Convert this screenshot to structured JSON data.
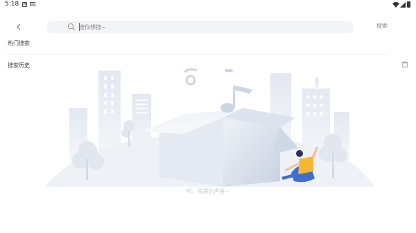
{
  "status_bar": {
    "time": "5:18",
    "notification_icon": "a-badge-icon"
  },
  "header": {
    "back_icon": "chevron-left-icon",
    "search": {
      "placeholder": "搜你想搜~",
      "value": ""
    },
    "search_button_label": "搜索"
  },
  "sections": {
    "hot_search_title": "热门搜索",
    "history_title": "搜索历史",
    "clear_history_icon": "trash-icon"
  },
  "empty_state": {
    "illustration": "music-box-city-illustration",
    "message": "听。海哭的声音~"
  },
  "colors": {
    "accent": "#1f8f5a",
    "search_bg": "#f3f4f6",
    "muted_text": "#8a8a8a",
    "illustration_blue": "#d6dde9"
  }
}
